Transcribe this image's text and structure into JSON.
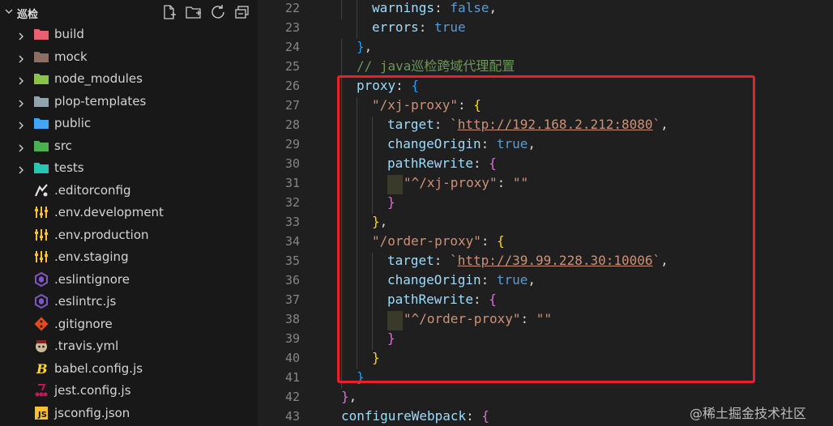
{
  "explorer": {
    "title": "巡检",
    "actions": [
      "new-file",
      "new-folder",
      "refresh",
      "collapse-all"
    ],
    "items": [
      {
        "label": "build",
        "type": "folder",
        "icon": "build-folder-icon",
        "color": "#e8616f"
      },
      {
        "label": "mock",
        "type": "folder",
        "icon": "mock-folder-icon",
        "color": "#8d6e63"
      },
      {
        "label": "node_modules",
        "type": "folder",
        "icon": "node-folder-icon",
        "color": "#8bc34a"
      },
      {
        "label": "plop-templates",
        "type": "folder",
        "icon": "folder-icon",
        "color": "#90a4ae"
      },
      {
        "label": "public",
        "type": "folder",
        "icon": "public-folder-icon",
        "color": "#42a5f5"
      },
      {
        "label": "src",
        "type": "folder",
        "icon": "src-folder-icon",
        "color": "#4caf50"
      },
      {
        "label": "tests",
        "type": "folder",
        "icon": "tests-folder-icon",
        "color": "#26c6b0"
      },
      {
        "label": ".editorconfig",
        "type": "file",
        "icon": "editorconfig-icon",
        "color": "#e0e0e0"
      },
      {
        "label": ".env.development",
        "type": "file",
        "icon": "env-icon",
        "color": "#fbc02d"
      },
      {
        "label": ".env.production",
        "type": "file",
        "icon": "env-icon",
        "color": "#fbc02d"
      },
      {
        "label": ".env.staging",
        "type": "file",
        "icon": "env-icon",
        "color": "#fbc02d"
      },
      {
        "label": ".eslintignore",
        "type": "file",
        "icon": "eslint-icon",
        "color": "#7e57c2"
      },
      {
        "label": ".eslintrc.js",
        "type": "file",
        "icon": "eslint-icon",
        "color": "#7e57c2"
      },
      {
        "label": ".gitignore",
        "type": "file",
        "icon": "git-icon",
        "color": "#e64a19"
      },
      {
        "label": ".travis.yml",
        "type": "file",
        "icon": "travis-icon",
        "color": "#cdb89a"
      },
      {
        "label": "babel.config.js",
        "type": "file",
        "icon": "babel-icon",
        "color": "#fdd835"
      },
      {
        "label": "jest.config.js",
        "type": "file",
        "icon": "jest-icon",
        "color": "#c2185b"
      },
      {
        "label": "jsconfig.json",
        "type": "file",
        "icon": "jsconfig-icon",
        "color": "#fbc02d"
      }
    ]
  },
  "editor": {
    "line_numbers": [
      "22",
      "23",
      "24",
      "25",
      "26",
      "27",
      "28",
      "29",
      "30",
      "31",
      "32",
      "33",
      "34",
      "35",
      "36",
      "37",
      "38",
      "39",
      "40",
      "41",
      "42",
      "43"
    ],
    "code": {
      "l22": {
        "key": "warnings",
        "colon": ": ",
        "value": "false",
        "end": ","
      },
      "l23": {
        "key": "errors",
        "colon": ": ",
        "value": "true"
      },
      "l24": {
        "brace": "}",
        "end": ","
      },
      "l25": {
        "comment": "// java巡检跨域代理配置"
      },
      "l26": {
        "key": "proxy",
        "colon": ": ",
        "brace": "{"
      },
      "l27": {
        "key": "\"/xj-proxy\"",
        "colon": ": ",
        "brace": "{"
      },
      "l28": {
        "key": "target",
        "colon": ": ",
        "q1": "`",
        "url": "http://192.168.2.212:8080",
        "q2": "`",
        "end": ","
      },
      "l29": {
        "key": "changeOrigin",
        "colon": ": ",
        "value": "true",
        "end": ","
      },
      "l30": {
        "key": "pathRewrite",
        "colon": ": ",
        "brace": "{"
      },
      "l31": {
        "key": "\"^/xj-proxy\"",
        "colon": ": ",
        "value": "\"\""
      },
      "l32": {
        "brace": "}"
      },
      "l33": {
        "brace": "}",
        "end": ","
      },
      "l34": {
        "key": "\"/order-proxy\"",
        "colon": ": ",
        "brace": "{"
      },
      "l35": {
        "key": "target",
        "colon": ": ",
        "q1": "`",
        "url": "http://39.99.228.30:10006",
        "q2": "`",
        "end": ","
      },
      "l36": {
        "key": "changeOrigin",
        "colon": ": ",
        "value": "true",
        "end": ","
      },
      "l37": {
        "key": "pathRewrite",
        "colon": ": ",
        "brace": "{"
      },
      "l38": {
        "key": "\"^/order-proxy\"",
        "colon": ": ",
        "value": "\"\""
      },
      "l39": {
        "brace": "}"
      },
      "l40": {
        "brace": "}"
      },
      "l41": {
        "brace": "}"
      },
      "l42": {
        "brace": "}",
        "end": ","
      },
      "l43": {
        "key": "configureWebpack",
        "colon": ": ",
        "brace": "{"
      }
    },
    "highlight_color": "#e8202a"
  },
  "watermark": "@稀土掘金技术社区"
}
